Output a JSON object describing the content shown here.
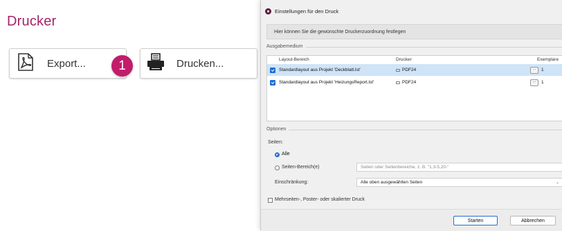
{
  "left_panel": {
    "title": "Drucker",
    "export_button": {
      "label": "Export...",
      "icon": "pdf-icon"
    },
    "print_button": {
      "label": "Drucken...",
      "icon": "printer-icon"
    },
    "step_badge": "1"
  },
  "dialog": {
    "title": "Einstellungen für den Druck",
    "info_text": "Hier können Sie die gewünschte Druckerzuordnung festlegen",
    "output_group_label": "Ausgabemedium",
    "columns": {
      "layout": "Layout-Bereich",
      "printer": "Drucker",
      "copies": "Exemplare"
    },
    "rows": [
      {
        "layout": "Standardlayout aus Projekt 'Deckblatt.lst'",
        "printer": "PDF24",
        "more": "...",
        "copies": "1",
        "selected": true,
        "checked": true
      },
      {
        "layout": "Standardlayout aus Projekt 'HeizungsReport.lst'",
        "printer": "PDF24",
        "more": "...",
        "copies": "1",
        "selected": false,
        "checked": true
      }
    ],
    "options_group_label": "Optionen",
    "pages_label": "Seiten:",
    "radio_all": "Alle",
    "radio_range": "Seiten-Bereich(e)",
    "range_placeholder": "Seiten oder Seitenbereiche, z. B. \"1,3-5,20-\"",
    "restriction_label": "Einschränkung:",
    "restriction_value": "Alle oben ausgewählten Seiten",
    "multipage_label": "Mehrseiten-, Poster- oder skalierter Druck",
    "start_button": "Starten",
    "cancel_button": "Abbrechen"
  },
  "colors": {
    "accent": "#a3246a",
    "badge": "#c21c6b",
    "selection": "#cfe4f7",
    "checkbox_blue": "#1f6fd1"
  }
}
